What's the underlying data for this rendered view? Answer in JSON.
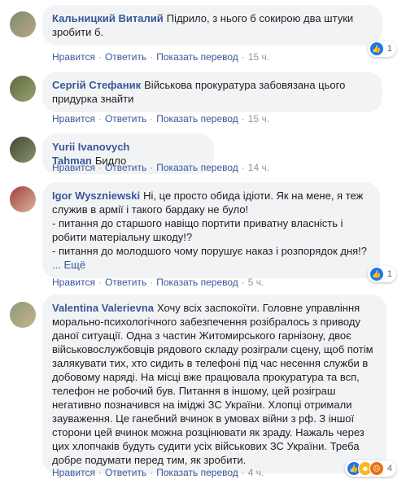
{
  "actions": {
    "like": "Нравится",
    "reply": "Ответить",
    "translate": "Показать перевод"
  },
  "comments": [
    {
      "author": "Кальницкий Виталий",
      "text": "Підрило, з нього б сокирою два штуки зробити б.",
      "time": "15 ч.",
      "reaction_count": "1"
    },
    {
      "author": "Сергій Стефаник",
      "text": "Військова прокуратура забовязана цього придурка знайти",
      "time": "15 ч."
    },
    {
      "author": "Yurii Ivanovych Tahman",
      "text": "Бидло",
      "time": "14 ч."
    },
    {
      "author": "Igor Wyszniewski",
      "lines": [
        "Ні, це просто обида ідіоти. Як на мене, я теж",
        "служив в армії і такого бардаку не було!",
        "- питання до старшого навіщо портити приватну власність і",
        "робити матеріальну шкоду!?",
        "- питання до молодшого чому порушує наказ і розпорядок дня!?"
      ],
      "more": "... Ещё",
      "time": "5 ч.",
      "reaction_count": "1"
    },
    {
      "author": "Valentina Valerievna",
      "text": "Хочу всіх заспокоїти. Головне управління морально-психологічного забезпечення розібралось з приводу даної ситуації. Одна з частин Житомирського гарнізону, двоє військовослужбовців рядового складу розіграли сцену, щоб потім залякувати тих, хто сидить в телефоні під час несення служби в добовому наряді. На місці вже працювала прокуратура та всп, телефон не робочий був. Питання в іншому, цей розіграш негативно позначився на іміджі ЗС України. Хлопці отримали зауваження. Це ганебний вчинок в умовах війни з рф. З іншої сторони цей вчинок можна розцінювати як зраду. Нажаль через цих хлопчаків будуть судити усіх військових ЗС України. Треба добре подумати перед тим, як зробити.",
      "time": "4 ч.",
      "reaction_count": "4"
    }
  ]
}
